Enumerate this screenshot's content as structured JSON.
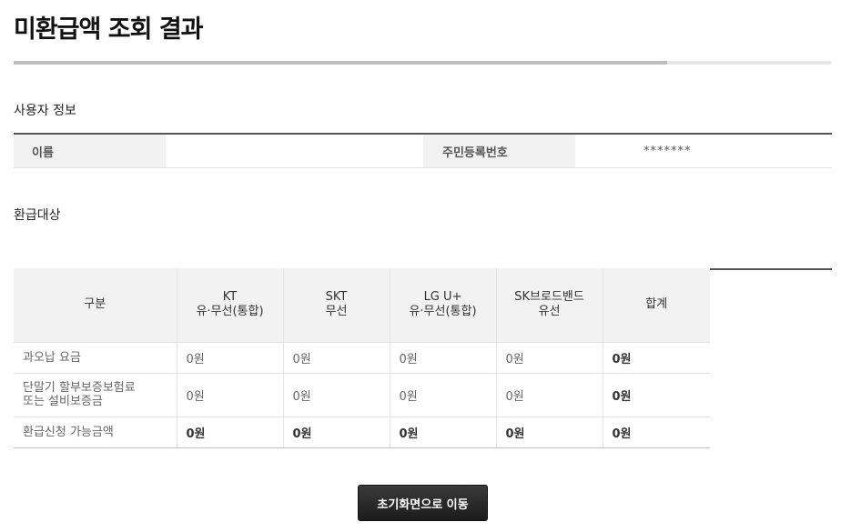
{
  "page": {
    "title": "미환급액 조회 결과",
    "progress_percent": 80
  },
  "user_section": {
    "title": "사용자 정보",
    "name_label": "이름",
    "name_value": "",
    "id_label": "주민등록번호",
    "id_value": "*******"
  },
  "refund_section": {
    "title": "환급대상",
    "headers": {
      "category": "구분",
      "kt_line1": "KT",
      "kt_line2": "유·무선(통합)",
      "skt_line1": "SKT",
      "skt_line2": "무선",
      "lg_line1": "LG U+",
      "lg_line2": "유·무선(통합)",
      "skb_line1": "SK브로드밴드",
      "skb_line2": "유선",
      "total": "합계"
    },
    "rows": [
      {
        "label_line1": "과오납 요금",
        "label_line2": "",
        "kt": "0원",
        "skt": "0원",
        "lg": "0원",
        "skb": "0원",
        "total": "0원"
      },
      {
        "label_line1": "단말기 할부보증보험료",
        "label_line2": "또는 설비보증금",
        "kt": "0원",
        "skt": "0원",
        "lg": "0원",
        "skb": "0원",
        "total": "0원"
      },
      {
        "label_line1": "환급신청 가능금액",
        "label_line2": "",
        "kt": "0원",
        "skt": "0원",
        "lg": "0원",
        "skb": "0원",
        "total": "0원"
      }
    ]
  },
  "actions": {
    "home_button_label": "초기화면으로 이동"
  }
}
